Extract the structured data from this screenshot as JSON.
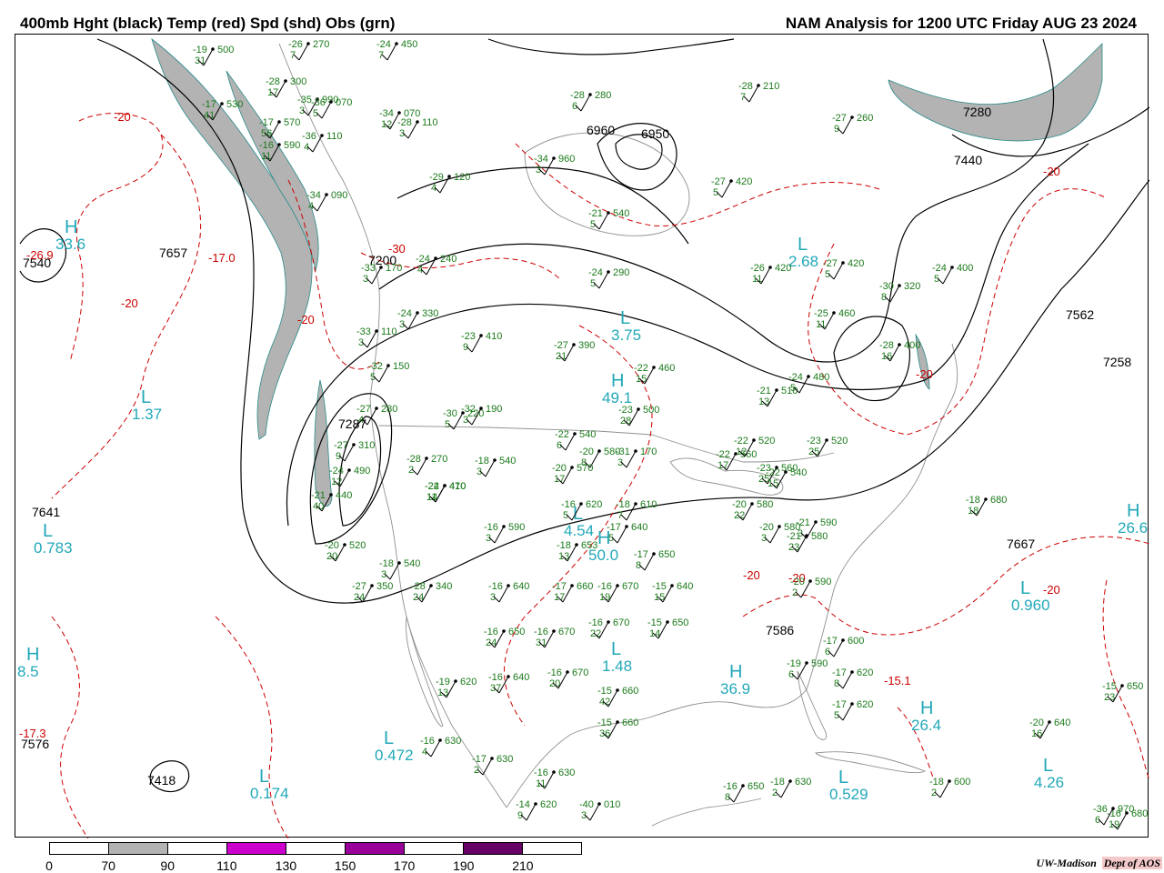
{
  "header": {
    "left_title": "400mb Hght (black) Temp (red) Spd (shd) Obs (grn)",
    "right_title": "NAM Analysis for 1200 UTC Friday  AUG 23 2024"
  },
  "colors": {
    "height": "#000000",
    "temperature": "#cc0000",
    "speed_label": "#22a8b8",
    "obs": "#1a7a1a",
    "shade_70_90": "#b3b3b3",
    "shade_110_130": "#cc00cc",
    "shade_150_170": "#990099",
    "shade_190_210": "#660066",
    "geography": "#909090"
  },
  "colorbar": {
    "labels": [
      "0",
      "70",
      "90",
      "110",
      "130",
      "150",
      "170",
      "190",
      "210"
    ],
    "segments": [
      "#ffffff",
      "#b3b3b3",
      "#ffffff",
      "#cc00cc",
      "#ffffff",
      "#990099",
      "#ffffff",
      "#660066",
      "#ffffff"
    ]
  },
  "credit": {
    "org": "UW-Madison",
    "dept": "Dept of AOS"
  },
  "height_labels": [
    {
      "text": "7540"
    },
    {
      "text": "7657"
    },
    {
      "text": "7200"
    },
    {
      "text": "6960"
    },
    {
      "text": "6950"
    },
    {
      "text": "7440"
    },
    {
      "text": "7280"
    },
    {
      "text": "7562"
    },
    {
      "text": "7258"
    },
    {
      "text": "7641"
    },
    {
      "text": "7667"
    },
    {
      "text": "7586"
    },
    {
      "text": "7576"
    },
    {
      "text": "7418"
    },
    {
      "text": "7287"
    }
  ],
  "temp_labels": [
    {
      "text": "-20"
    },
    {
      "text": "-20"
    },
    {
      "text": "-20"
    },
    {
      "text": "-30"
    },
    {
      "text": "-20"
    },
    {
      "text": "-20"
    },
    {
      "text": "-20"
    },
    {
      "text": "-20"
    },
    {
      "text": "-20"
    },
    {
      "text": "-17.0"
    },
    {
      "text": "-15.1"
    },
    {
      "text": "-17.3"
    },
    {
      "text": "-26.9"
    }
  ],
  "speed_labels": [
    {
      "text": "H",
      "value": "33.6"
    },
    {
      "text": "L",
      "value": "1.37"
    },
    {
      "text": "L",
      "value": "0.783"
    },
    {
      "text": "H",
      "value": "8.5"
    },
    {
      "text": "L",
      "value": "0.472"
    },
    {
      "text": "L",
      "value": "0.174"
    },
    {
      "text": "L",
      "value": "3.75"
    },
    {
      "text": "L",
      "value": "2.68"
    },
    {
      "text": "L",
      "value": "1.48"
    },
    {
      "text": "H",
      "value": "36.9"
    },
    {
      "text": "L",
      "value": "0.960"
    },
    {
      "text": "H",
      "value": "26.4"
    },
    {
      "text": "L",
      "value": "0.529"
    },
    {
      "text": "L",
      "value": "4.26"
    },
    {
      "text": "H",
      "value": "26.6"
    },
    {
      "text": "L",
      "value": "4.54"
    },
    {
      "text": "H",
      "value": "49.1"
    },
    {
      "text": "H",
      "value": "50.0"
    }
  ],
  "observations": [
    {
      "t": "-24",
      "h": "240",
      "d": "4"
    },
    {
      "t": "-24",
      "h": "330",
      "d": "3"
    },
    {
      "t": "-23",
      "h": "410",
      "d": "9"
    },
    {
      "t": "-27",
      "h": "390",
      "d": "21"
    },
    {
      "t": "-22",
      "h": "460",
      "d": "15"
    },
    {
      "t": "-23",
      "h": "500",
      "d": "28"
    },
    {
      "t": "-22",
      "h": "540",
      "d": "6"
    },
    {
      "t": "-20",
      "h": "580",
      "d": "8"
    },
    {
      "t": "-18",
      "h": "540",
      "d": "3"
    },
    {
      "t": "-20",
      "h": "570",
      "d": "17"
    },
    {
      "t": "-16",
      "h": "620",
      "d": "5"
    },
    {
      "t": "-18",
      "h": "610",
      "d": "7"
    },
    {
      "t": "-17",
      "h": "640",
      "d": "5"
    },
    {
      "t": "-18",
      "h": "653",
      "d": "13"
    },
    {
      "t": "-17",
      "h": "650",
      "d": "8"
    },
    {
      "t": "-16",
      "h": "590",
      "d": "3"
    },
    {
      "t": "-16",
      "h": "640",
      "d": "3"
    },
    {
      "t": "-16",
      "h": "650",
      "d": "24"
    },
    {
      "t": "-16",
      "h": "670",
      "d": "31"
    },
    {
      "t": "-17",
      "h": "660",
      "d": "17"
    },
    {
      "t": "-16",
      "h": "670",
      "d": "19"
    },
    {
      "t": "-16",
      "h": "670",
      "d": "22"
    },
    {
      "t": "-15",
      "h": "650",
      "d": "14"
    },
    {
      "t": "-15",
      "h": "640",
      "d": "15"
    },
    {
      "t": "-19",
      "h": "620",
      "d": "13"
    },
    {
      "t": "-16",
      "h": "640",
      "d": "37"
    },
    {
      "t": "-16",
      "h": "670",
      "d": "20"
    },
    {
      "t": "-15",
      "h": "660",
      "d": "42"
    },
    {
      "t": "-15",
      "h": "660",
      "d": "36"
    },
    {
      "t": "-16",
      "h": "630",
      "d": "4"
    },
    {
      "t": "-17",
      "h": "630",
      "d": "2"
    },
    {
      "t": "-16",
      "h": "630",
      "d": "11"
    },
    {
      "t": "-14",
      "h": "620",
      "d": "9"
    },
    {
      "t": "-16",
      "h": "650",
      "d": "8"
    },
    {
      "t": "-18",
      "h": "630",
      "d": "2"
    },
    {
      "t": "-18",
      "h": "600",
      "d": "2"
    },
    {
      "t": "-16",
      "h": "680",
      "d": "19"
    },
    {
      "t": "-20",
      "h": "640",
      "d": "16"
    },
    {
      "t": "-15",
      "h": "650",
      "d": "23"
    },
    {
      "t": "-18",
      "h": "680",
      "d": "18"
    },
    {
      "t": "-17",
      "h": "620",
      "d": "8"
    },
    {
      "t": "-17",
      "h": "620",
      "d": "5"
    },
    {
      "t": "-17",
      "h": "600",
      "d": "6"
    },
    {
      "t": "-19",
      "h": "590",
      "d": "6"
    },
    {
      "t": "-20",
      "h": "590",
      "d": "2"
    },
    {
      "t": "-21",
      "h": "580",
      "d": "23"
    },
    {
      "t": "-21",
      "h": "590",
      "d": "3"
    },
    {
      "t": "-20",
      "h": "580",
      "d": "22"
    },
    {
      "t": "-20",
      "h": "580",
      "d": "3"
    },
    {
      "t": "-23",
      "h": "560",
      "d": "25"
    },
    {
      "t": "-22",
      "h": "560",
      "d": "17"
    },
    {
      "t": "-22",
      "h": "520",
      "d": "12"
    },
    {
      "t": "-22",
      "h": "540",
      "d": "15"
    },
    {
      "t": "-23",
      "h": "520",
      "d": "25"
    },
    {
      "t": "-21",
      "h": "510",
      "d": "13"
    },
    {
      "t": "-24",
      "h": "480",
      "d": "5"
    },
    {
      "t": "-25",
      "h": "460",
      "d": "11"
    },
    {
      "t": "-27",
      "h": "420",
      "d": "5"
    },
    {
      "t": "-26",
      "h": "420",
      "d": "11"
    },
    {
      "t": "-30",
      "h": "320",
      "d": "8"
    },
    {
      "t": "-28",
      "h": "400",
      "d": "16"
    },
    {
      "t": "-24",
      "h": "400",
      "d": "5"
    },
    {
      "t": "-27",
      "h": "420",
      "d": "5"
    },
    {
      "t": "-21",
      "h": "540",
      "d": "5"
    },
    {
      "t": "-27",
      "h": "260",
      "d": "9"
    },
    {
      "t": "-28",
      "h": "210",
      "d": "7"
    },
    {
      "t": "-28",
      "h": "280",
      "d": "6"
    },
    {
      "t": "-28",
      "h": "110",
      "d": "3"
    },
    {
      "t": "-29",
      "h": "120",
      "d": "4"
    },
    {
      "t": "-34",
      "h": "960",
      "d": "3"
    },
    {
      "t": "-34",
      "h": "070",
      "d": "12"
    },
    {
      "t": "-35",
      "h": "990",
      "d": "3"
    },
    {
      "t": "-34",
      "h": "090",
      "d": "4"
    },
    {
      "t": "-36",
      "h": "070",
      "d": "5"
    },
    {
      "t": "-36",
      "h": "110",
      "d": "4"
    },
    {
      "t": "-33",
      "h": "170",
      "d": "3"
    },
    {
      "t": "-33",
      "h": "110",
      "d": "3"
    },
    {
      "t": "-32",
      "h": "150",
      "d": "5"
    },
    {
      "t": "-27",
      "h": "280",
      "d": "4"
    },
    {
      "t": "-27",
      "h": "310",
      "d": "9"
    },
    {
      "t": "-28",
      "h": "270",
      "d": "2"
    },
    {
      "t": "-30",
      "h": "220",
      "d": "5"
    },
    {
      "t": "-32",
      "h": "190",
      "d": "3"
    },
    {
      "t": "-24",
      "h": "410",
      "d": "11"
    },
    {
      "t": "-22",
      "h": "470",
      "d": "14"
    },
    {
      "t": "-24",
      "h": "490",
      "d": "12"
    },
    {
      "t": "-21",
      "h": "440",
      "d": "40"
    },
    {
      "t": "-20",
      "h": "520",
      "d": "20"
    },
    {
      "t": "-18",
      "h": "540",
      "d": "3"
    },
    {
      "t": "-27",
      "h": "350",
      "d": "24"
    },
    {
      "t": "-28",
      "h": "340",
      "d": "24"
    },
    {
      "t": "-19",
      "h": "500",
      "d": "31"
    },
    {
      "t": "-17",
      "h": "530",
      "d": "41"
    },
    {
      "t": "-17",
      "h": "570",
      "d": "56"
    },
    {
      "t": "-16",
      "h": "590",
      "d": "11"
    },
    {
      "t": "-28",
      "h": "300",
      "d": "17"
    },
    {
      "t": "-24",
      "h": "450",
      "d": "7"
    },
    {
      "t": "-26",
      "h": "270",
      "d": "7"
    },
    {
      "t": "-24",
      "h": "290",
      "d": "5"
    },
    {
      "t": "-31",
      "h": "170",
      "d": "3"
    },
    {
      "t": "-36",
      "h": "970",
      "d": "6"
    },
    {
      "t": "-40",
      "h": "010",
      "d": "3"
    },
    {
      "t": "-23",
      "h": "320",
      "d": "25"
    },
    {
      "t": "-20",
      "h": "580",
      "d": "16"
    },
    {
      "t": "-19",
      "h": "630",
      "d": "22"
    },
    {
      "t": "-15",
      "h": "630",
      "d": "7"
    },
    {
      "t": "-15",
      "h": "640",
      "d": "4"
    }
  ]
}
